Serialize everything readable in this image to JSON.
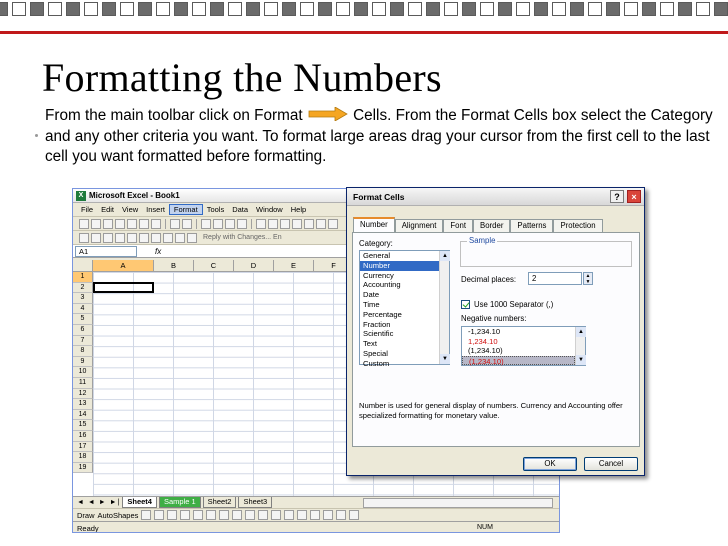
{
  "slide": {
    "title": "Formatting the Numbers",
    "body_part1": "From the main toolbar click on Format",
    "body_part2": "Cells.  From the Format Cells box select the Category and any other criteria you want.  To format large areas drag your cursor from the first cell to the last cell you want formatted before formatting."
  },
  "colors": {
    "accent_red": "#c0181a",
    "arrow_orange": "#f5a623",
    "selection_blue": "#316ac5",
    "negative_red": "#d01010"
  },
  "excel": {
    "title": "Microsoft Excel - Book1",
    "menu": [
      "File",
      "Edit",
      "View",
      "Insert",
      "Format",
      "Tools",
      "Data",
      "Window",
      "Help"
    ],
    "active_menu": "Format",
    "reply_text": "Reply with Changes... En",
    "namebox": "A1",
    "fx": "fx",
    "columns": [
      "A",
      "B",
      "C",
      "D",
      "E",
      "F"
    ],
    "rows": [
      "1",
      "2",
      "3",
      "4",
      "5",
      "6",
      "7",
      "8",
      "9",
      "10",
      "11",
      "12",
      "13",
      "14",
      "15",
      "16",
      "17",
      "18",
      "19"
    ],
    "tab_nav": "◄ ◄ ► ►|",
    "sheet_tabs": [
      "Sheet4",
      "Sample 1",
      "Sheet2",
      "Sheet3"
    ],
    "draw_label": "Draw",
    "autoshapes_label": "AutoShapes",
    "status": "Ready",
    "status_num": "NUM"
  },
  "dialog": {
    "title": "Format Cells",
    "help": "?",
    "close": "×",
    "tabs": [
      "Number",
      "Alignment",
      "Font",
      "Border",
      "Patterns",
      "Protection"
    ],
    "active_tab": "Number",
    "category_label": "Category:",
    "categories": [
      "General",
      "Number",
      "Currency",
      "Accounting",
      "Date",
      "Time",
      "Percentage",
      "Fraction",
      "Scientific",
      "Text",
      "Special",
      "Custom"
    ],
    "selected_category": "Number",
    "sample_label": "Sample",
    "decimal_label": "Decimal places:",
    "decimal_value": "2",
    "separator_label": "Use 1000 Separator (,)",
    "negative_label": "Negative numbers:",
    "negatives": [
      "-1,234.10",
      "1,234.10",
      "(1,234.10)",
      "(1,234.10)"
    ],
    "description": "Number is used for general display of numbers.  Currency and Accounting offer specialized formatting for monetary value.",
    "ok": "OK",
    "cancel": "Cancel"
  }
}
